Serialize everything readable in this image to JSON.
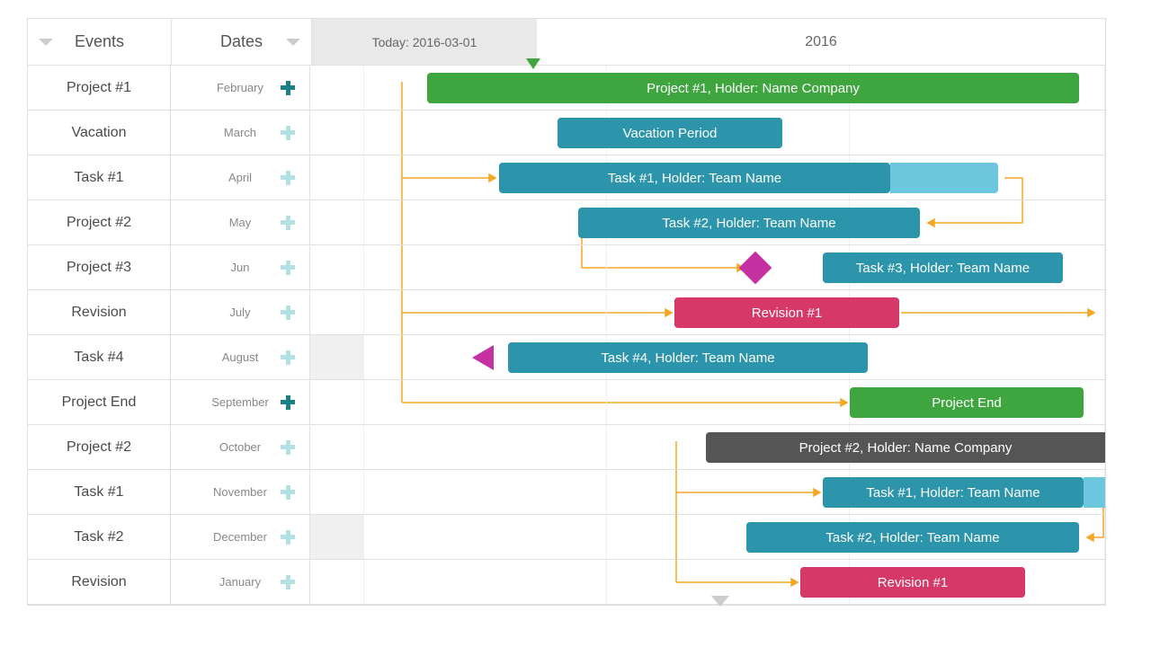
{
  "header": {
    "events": "Events",
    "dates": "Dates",
    "today": "Today: 2016-03-01",
    "year": "2016"
  },
  "rows": [
    {
      "event": "Project #1",
      "date": "February",
      "plus": "dark"
    },
    {
      "event": "Vacation",
      "date": "March",
      "plus": "light"
    },
    {
      "event": "Task #1",
      "date": "April",
      "plus": "light"
    },
    {
      "event": "Project #2",
      "date": "May",
      "plus": "light"
    },
    {
      "event": "Project #3",
      "date": "Jun",
      "plus": "light"
    },
    {
      "event": "Revision",
      "date": "July",
      "plus": "light"
    },
    {
      "event": "Task #4",
      "date": "August",
      "plus": "light"
    },
    {
      "event": "Project End",
      "date": "September",
      "plus": "dark"
    },
    {
      "event": "Project #2",
      "date": "October",
      "plus": "light"
    },
    {
      "event": "Task #1",
      "date": "November",
      "plus": "light"
    },
    {
      "event": "Task #2",
      "date": "December",
      "plus": "light"
    },
    {
      "event": "Revision",
      "date": "January",
      "plus": "light"
    }
  ],
  "bars": {
    "r0": "Project #1, Holder: Name Company",
    "r1": "Vacation Period",
    "r2": "Task #1, Holder: Team Name",
    "r3": "Task #2, Holder: Team Name",
    "r4": "Task #3, Holder: Team Name",
    "r5": "Revision #1",
    "r6": "Task #4, Holder: Team Name",
    "r7": "Project End",
    "r8": "Project #2, Holder: Name Company",
    "r9": "Task #1, Holder: Team Name",
    "r10": "Task #2, Holder: Team Name",
    "r11": "Revision #1"
  },
  "chart_data": {
    "type": "gantt",
    "title": "Events / 2016",
    "today": "2016-03-01",
    "x_unit": "percent_of_timeline_width",
    "tasks": [
      {
        "row": 0,
        "event": "Project #1",
        "month": "February",
        "label": "Project #1, Holder: Name Company",
        "color": "#3fa53f",
        "start": 15,
        "end": 97
      },
      {
        "row": 1,
        "event": "Vacation",
        "month": "March",
        "label": "Vacation Period",
        "color": "#2c95ac",
        "start": 30,
        "end": 60
      },
      {
        "row": 2,
        "event": "Task #1",
        "month": "April",
        "label": "Task #1, Holder: Team Name",
        "color": "#2c95ac",
        "start": 24,
        "end": 73,
        "progress_extension_end": 87
      },
      {
        "row": 3,
        "event": "Project #2",
        "month": "May",
        "label": "Task #2, Holder: Team Name",
        "color": "#2c95ac",
        "start": 34,
        "end": 77
      },
      {
        "row": 4,
        "event": "Project #3",
        "month": "Jun",
        "label": "Task #3, Holder: Team Name",
        "color": "#2c95ac",
        "start": 65,
        "end": 95,
        "milestone_at": 56,
        "milestone_shape": "diamond",
        "milestone_color": "#c531a1"
      },
      {
        "row": 5,
        "event": "Revision",
        "month": "July",
        "label": "Revision #1",
        "color": "#d63868",
        "start": 46,
        "end": 74
      },
      {
        "row": 6,
        "event": "Task #4",
        "month": "August",
        "label": "Task #4, Holder: Team Name",
        "color": "#2c95ac",
        "start": 25,
        "end": 70,
        "marker_at": 20,
        "marker_shape": "triangle-left",
        "marker_color": "#c531a1"
      },
      {
        "row": 7,
        "event": "Project End",
        "month": "September",
        "label": "Project End",
        "color": "#3fa53f",
        "start": 68,
        "end": 98
      },
      {
        "row": 8,
        "event": "Project #2",
        "month": "October",
        "label": "Project #2, Holder: Name Company",
        "color": "#555555",
        "start": 50,
        "end": 100
      },
      {
        "row": 9,
        "event": "Task #1",
        "month": "November",
        "label": "Task #1, Holder: Team Name",
        "color": "#2c95ac",
        "start": 65,
        "end": 98,
        "progress_extension_end": 102
      },
      {
        "row": 10,
        "event": "Task #2",
        "month": "December",
        "label": "Task #2, Holder: Team Name",
        "color": "#2c95ac",
        "start": 55,
        "end": 97
      },
      {
        "row": 11,
        "event": "Revision",
        "month": "January",
        "label": "Revision #1",
        "color": "#d63868",
        "start": 62,
        "end": 90
      }
    ],
    "dependencies": [
      {
        "from_row": 0,
        "to_row": 2,
        "type": "start-to-start"
      },
      {
        "from_row": 2,
        "to_row": 3,
        "type": "finish-to-finish"
      },
      {
        "from_row": 3,
        "to_row": 4,
        "type": "start-to-milestone"
      },
      {
        "from_row": 0,
        "to_row": 5,
        "type": "start-to-start"
      },
      {
        "from_row": 5,
        "to_row": 7,
        "type": "finish-to-start"
      },
      {
        "from_row": 0,
        "to_row": 7,
        "type": "start-to-start"
      },
      {
        "from_row": 8,
        "to_row": 9,
        "type": "start-to-start"
      },
      {
        "from_row": 9,
        "to_row": 10,
        "type": "finish-to-finish"
      },
      {
        "from_row": 8,
        "to_row": 11,
        "type": "start-to-start"
      }
    ]
  }
}
